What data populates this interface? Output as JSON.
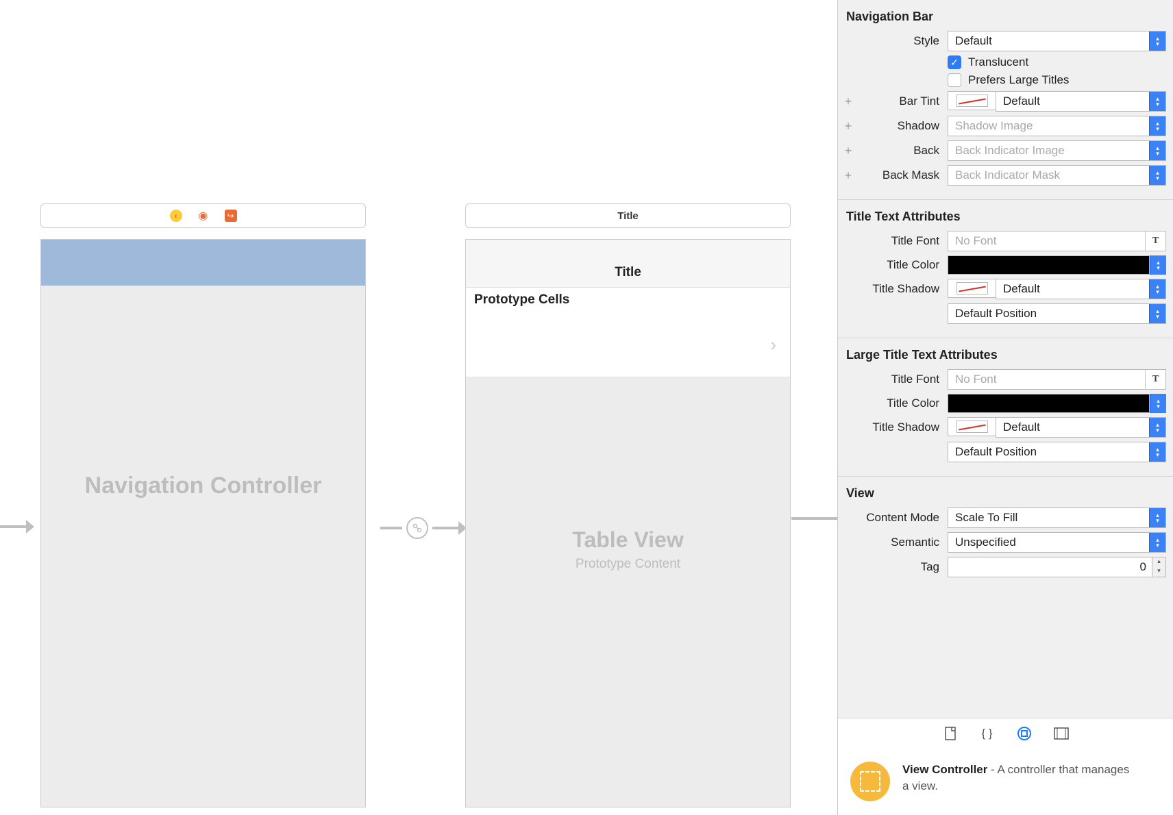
{
  "canvas": {
    "nav_scene": {
      "label": "Navigation Controller"
    },
    "table_scene": {
      "header_title": "Title",
      "nav_title": "Title",
      "prototype_header": "Prototype Cells",
      "big_title": "Table View",
      "big_subtitle": "Prototype Content"
    }
  },
  "inspector": {
    "navbar": {
      "section": "Navigation Bar",
      "style_label": "Style",
      "style_value": "Default",
      "translucent_label": "Translucent",
      "translucent_checked": true,
      "prefers_large_label": "Prefers Large Titles",
      "prefers_large_checked": false,
      "bartint_label": "Bar Tint",
      "bartint_value": "Default",
      "shadow_label": "Shadow",
      "shadow_placeholder": "Shadow Image",
      "back_label": "Back",
      "back_placeholder": "Back Indicator Image",
      "backmask_label": "Back Mask",
      "backmask_placeholder": "Back Indicator Mask"
    },
    "title_attrs": {
      "section": "Title Text Attributes",
      "font_label": "Title Font",
      "font_placeholder": "No Font",
      "color_label": "Title Color",
      "shadow_label": "Title Shadow",
      "shadow_value": "Default",
      "position_value": "Default Position"
    },
    "large_title_attrs": {
      "section": "Large Title Text Attributes",
      "font_label": "Title Font",
      "font_placeholder": "No Font",
      "color_label": "Title Color",
      "shadow_label": "Title Shadow",
      "shadow_value": "Default",
      "position_value": "Default Position"
    },
    "view": {
      "section": "View",
      "content_mode_label": "Content Mode",
      "content_mode_value": "Scale To Fill",
      "semantic_label": "Semantic",
      "semantic_value": "Unspecified",
      "tag_label": "Tag",
      "tag_value": "0"
    }
  },
  "library": {
    "item_title": "View Controller",
    "item_desc": " - A controller that manages a view."
  }
}
